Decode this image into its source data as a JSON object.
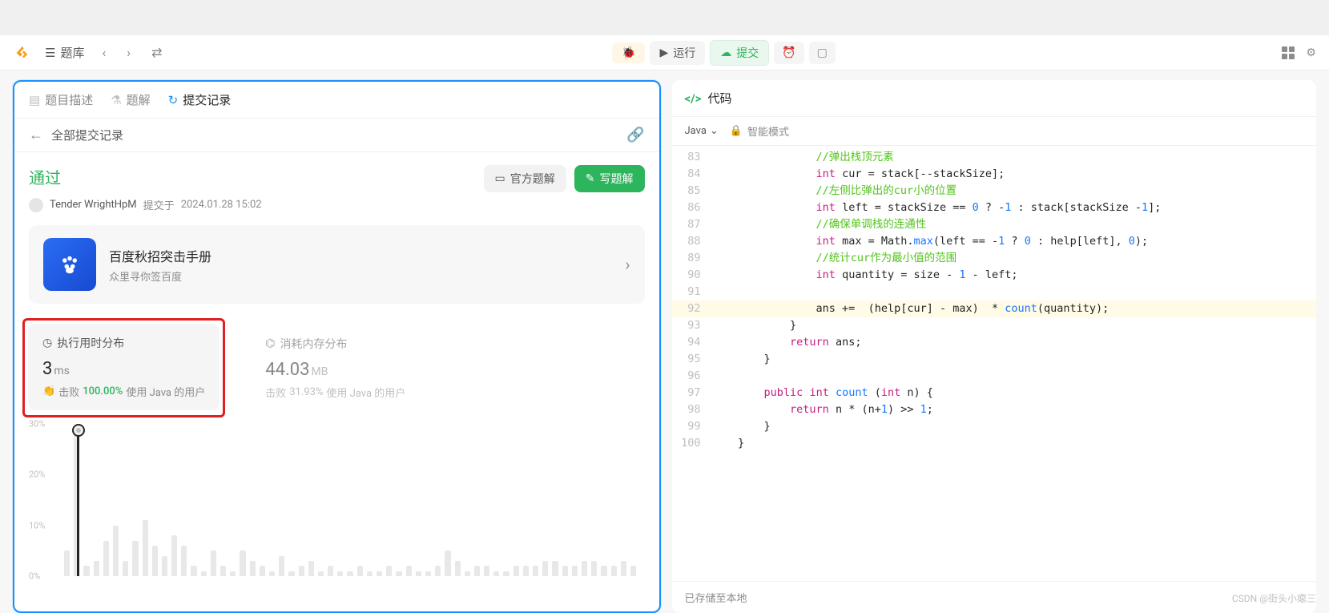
{
  "toolbar": {
    "library": "题库",
    "run": "运行",
    "submit": "提交"
  },
  "tabs": {
    "desc": "题目描述",
    "solution": "题解",
    "submissions": "提交记录"
  },
  "sub": {
    "all": "全部提交记录"
  },
  "result": {
    "status": "通过",
    "author": "Tender WrightHpM",
    "submitted_prefix": "提交于",
    "submitted_at": "2024.01.28 15:02",
    "official": "官方题解",
    "write": "写题解"
  },
  "promo": {
    "title": "百度秋招突击手册",
    "sub": "众里寻你签百度"
  },
  "stats": {
    "time_label": "执行用时分布",
    "time_val": "3",
    "time_unit": "ms",
    "time_beat_prefix": "击败",
    "time_beat_pct": "100.00%",
    "time_beat_suffix": "使用 Java 的用户",
    "mem_label": "消耗内存分布",
    "mem_val": "44.03",
    "mem_unit": "MB",
    "mem_beat_prefix": "击败",
    "mem_beat_pct": "31.93%",
    "mem_beat_suffix": "使用 Java 的用户"
  },
  "chart_data": {
    "type": "bar",
    "title": "执行用时分布",
    "ylabel": "%",
    "ylim": [
      0,
      30
    ],
    "yticks": [
      "30%",
      "20%",
      "10%",
      "0%"
    ],
    "marker_index": 1,
    "values": [
      5,
      28,
      2,
      3,
      7,
      10,
      3,
      7,
      11,
      6,
      4,
      8,
      6,
      2,
      1,
      5,
      2,
      1,
      5,
      3,
      2,
      1,
      4,
      1,
      2,
      3,
      1,
      2,
      1,
      1,
      2,
      1,
      1,
      2,
      1,
      2,
      1,
      1,
      2,
      5,
      3,
      1,
      2,
      2,
      1,
      1,
      2,
      2,
      2,
      3,
      3,
      2,
      2,
      3,
      3,
      2,
      2,
      3,
      2
    ]
  },
  "code": {
    "title": "代码",
    "lang": "Java",
    "ai": "智能模式",
    "saved": "已存储至本地",
    "lines": [
      {
        "n": 83,
        "html": "                <span class='cm'>//弹出栈顶元素</span>"
      },
      {
        "n": 84,
        "html": "                <span class='ty'>int</span> cur = stack[--stackSize];"
      },
      {
        "n": 85,
        "html": "                <span class='cm'>//左侧比弹出的cur小的位置</span>"
      },
      {
        "n": 86,
        "html": "                <span class='ty'>int</span> left = stackSize == <span class='num'>0</span> ? -<span class='num'>1</span> : stack[stackSize -<span class='num'>1</span>];"
      },
      {
        "n": 87,
        "html": "                <span class='cm'>//确保单调栈的连通性</span>"
      },
      {
        "n": 88,
        "html": "                <span class='ty'>int</span> max = Math.<span class='fn'>max</span>(left == -<span class='num'>1</span> ? <span class='num'>0</span> : help[left], <span class='num'>0</span>);"
      },
      {
        "n": 89,
        "html": "                <span class='cm'>//统计cur作为最小值的范围</span>"
      },
      {
        "n": 90,
        "html": "                <span class='ty'>int</span> quantity = size - <span class='num'>1</span> - left;"
      },
      {
        "n": 91,
        "html": ""
      },
      {
        "n": 92,
        "html": "                ans +=  (help[cur] - max)  * <span class='fn'>count</span>(quantity);",
        "hl": true
      },
      {
        "n": 93,
        "html": "            }"
      },
      {
        "n": 94,
        "html": "            <span class='kw'>return</span> ans;"
      },
      {
        "n": 95,
        "html": "        }"
      },
      {
        "n": 96,
        "html": ""
      },
      {
        "n": 97,
        "html": "        <span class='kw'>public</span> <span class='ty'>int</span> <span class='fn'>count</span> (<span class='ty'>int</span> n) {"
      },
      {
        "n": 98,
        "html": "            <span class='kw'>return</span> n * (n+<span class='num'>1</span>) &gt;&gt; <span class='num'>1</span>;"
      },
      {
        "n": 99,
        "html": "        }"
      },
      {
        "n": 100,
        "html": "    }"
      }
    ]
  },
  "watermark": "CSDN @街头小瘪三"
}
